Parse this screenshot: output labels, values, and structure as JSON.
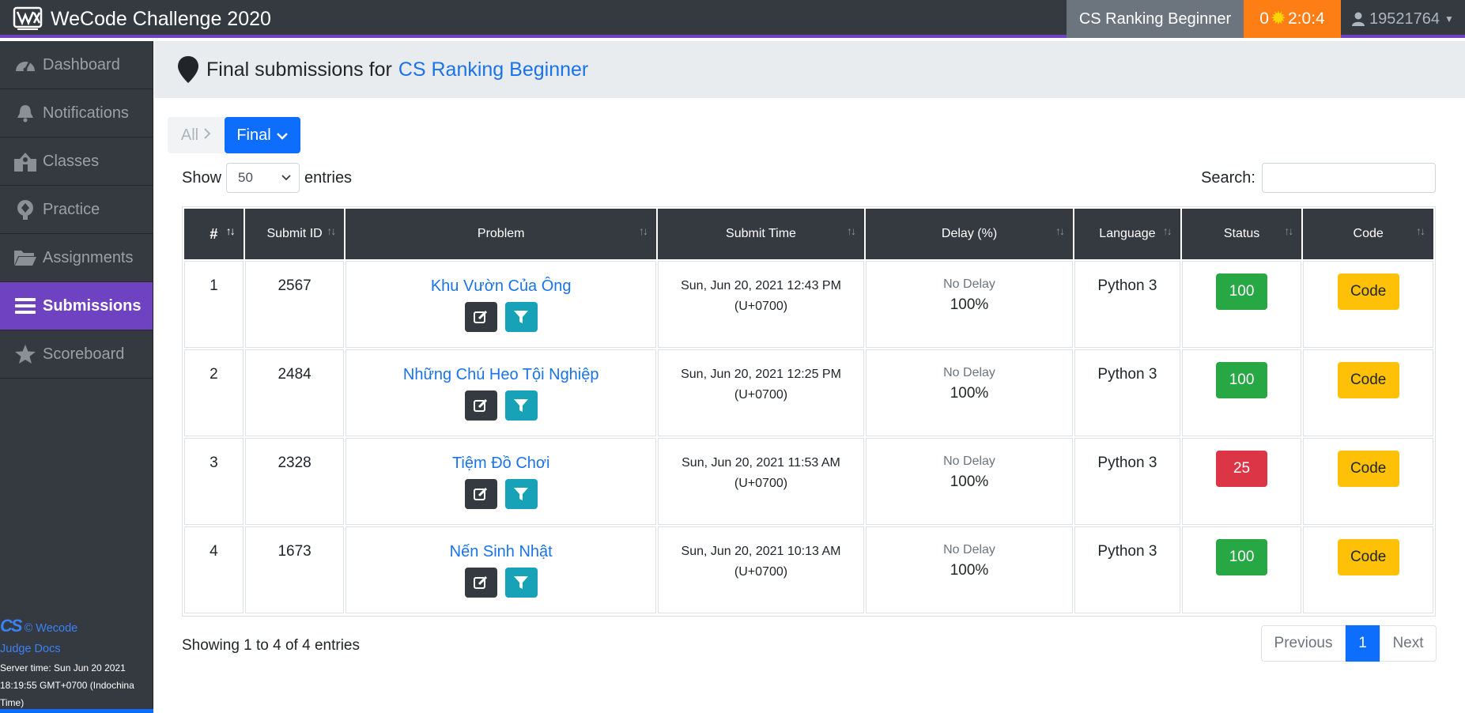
{
  "navbar": {
    "app_title": "WeCode Challenge 2020",
    "assignment": "CS Ranking Beginner",
    "timer": {
      "count": "0",
      "time": "2:0:4"
    },
    "user": "19521764"
  },
  "sidebar": {
    "items": [
      {
        "label": "Dashboard",
        "icon": "dashboard-icon"
      },
      {
        "label": "Notifications",
        "icon": "bell-icon"
      },
      {
        "label": "Classes",
        "icon": "school-icon"
      },
      {
        "label": "Practice",
        "icon": "practice-icon"
      },
      {
        "label": "Assignments",
        "icon": "folder-open-icon"
      },
      {
        "label": "Submissions",
        "icon": "list-icon",
        "active": true
      },
      {
        "label": "Scoreboard",
        "icon": "star-icon"
      }
    ],
    "footer": {
      "logo_text": "CS",
      "copyright": "© Wecode",
      "docs": "Judge Docs",
      "server_time": "Server time: Sun Jun 20 2021 18:19:55 GMT+0700 (Indochina Time)"
    }
  },
  "header": {
    "prefix": "Final submissions for",
    "assignment_link": "CS Ranking Beginner"
  },
  "breadcrumb": {
    "all": "All",
    "final": "Final"
  },
  "controls": {
    "show": "Show",
    "page_size": "50",
    "entries": "entries",
    "search_label": "Search:",
    "search_value": ""
  },
  "table": {
    "columns": [
      "#",
      "Submit ID",
      "Problem",
      "Submit Time",
      "Delay (%)",
      "Language",
      "Status",
      "Code"
    ],
    "rows": [
      {
        "n": "1",
        "id": "2567",
        "problem": "Khu Vườn Của Ông",
        "time": "Sun, Jun 20, 2021 12:43 PM",
        "tz": "(U+0700)",
        "delay_label": "No Delay",
        "delay": "100%",
        "lang": "Python 3",
        "status": "100",
        "status_type": "ok",
        "code": "Code"
      },
      {
        "n": "2",
        "id": "2484",
        "problem": "Những Chú Heo Tội Nghiệp",
        "time": "Sun, Jun 20, 2021 12:25 PM",
        "tz": "(U+0700)",
        "delay_label": "No Delay",
        "delay": "100%",
        "lang": "Python 3",
        "status": "100",
        "status_type": "ok",
        "code": "Code"
      },
      {
        "n": "3",
        "id": "2328",
        "problem": "Tiệm Đồ Chơi",
        "time": "Sun, Jun 20, 2021 11:53 AM",
        "tz": "(U+0700)",
        "delay_label": "No Delay",
        "delay": "100%",
        "lang": "Python 3",
        "status": "25",
        "status_type": "bad",
        "code": "Code"
      },
      {
        "n": "4",
        "id": "1673",
        "problem": "Nến Sinh Nhật",
        "time": "Sun, Jun 20, 2021 10:13 AM",
        "tz": "(U+0700)",
        "delay_label": "No Delay",
        "delay": "100%",
        "lang": "Python 3",
        "status": "100",
        "status_type": "ok",
        "code": "Code"
      }
    ]
  },
  "footer": {
    "showing": "Showing 1 to 4 of 4 entries",
    "previous": "Previous",
    "page": "1",
    "next": "Next"
  },
  "colors": {
    "navbar": "#343a40",
    "accent": "#6f42c1",
    "timer": "#fd7e14",
    "primary": "#0d6efd",
    "success": "#28a745",
    "danger": "#dc3545",
    "warning": "#ffc107",
    "info": "#17a2b8"
  }
}
